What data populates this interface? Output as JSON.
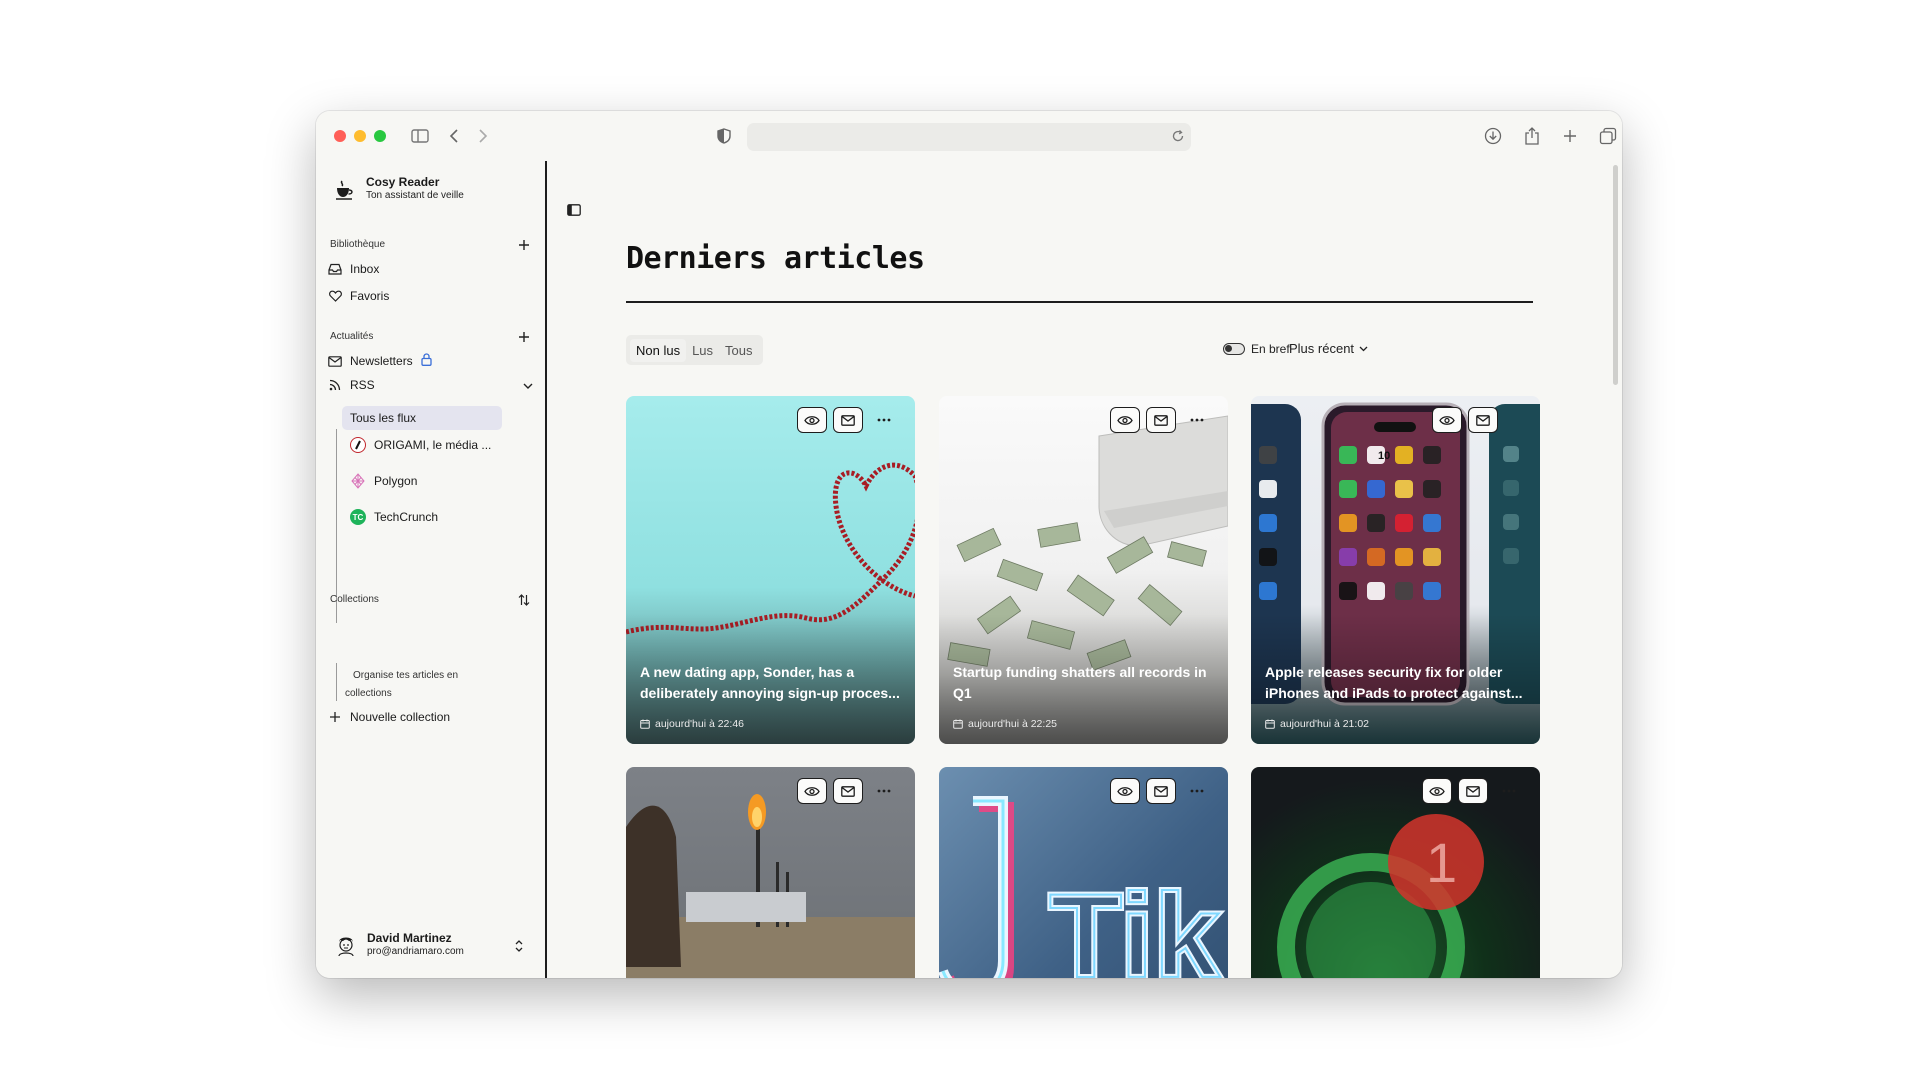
{
  "app": {
    "name": "Cosy Reader",
    "tagline": "Ton assistant de veille"
  },
  "sidebar": {
    "library": {
      "heading": "Bibliothèque",
      "items": [
        {
          "label": "Inbox",
          "icon": "inbox-icon"
        },
        {
          "label": "Favoris",
          "icon": "heart-icon"
        }
      ]
    },
    "news": {
      "heading": "Actualités",
      "newsletters_label": "Newsletters",
      "rss_label": "RSS",
      "feeds": [
        {
          "label": "Tous les flux",
          "active": true
        },
        {
          "label": "ORIGAMI, le média ...",
          "icon": "origami-favicon"
        },
        {
          "label": "Polygon",
          "icon": "polygon-favicon"
        },
        {
          "label": "TechCrunch",
          "icon": "techcrunch-favicon"
        }
      ]
    },
    "collections": {
      "heading": "Collections",
      "hint": "Organise tes articles en collections",
      "new_label": "Nouvelle collection"
    },
    "user": {
      "name": "David Martinez",
      "email": "pro@andriamaro.com"
    }
  },
  "main": {
    "title": "Derniers articles",
    "filters": [
      {
        "label": "Non lus",
        "active": true
      },
      {
        "label": "Lus",
        "active": false
      },
      {
        "label": "Tous",
        "active": false
      }
    ],
    "brief_label": "En bref",
    "sort_label": "Plus récent",
    "cards": [
      {
        "title": "A new dating app, Sonder, has a deliberately annoying sign-up proces...",
        "date": "aujourd'hui à 22:46",
        "image": "red-rope-heart"
      },
      {
        "title": "Startup funding shatters all records in Q1",
        "date": "aujourd'hui à 22:25",
        "image": "money-air-conditioner"
      },
      {
        "title": "Apple releases security fix for older iPhones and iPads to protect against...",
        "date": "aujourd'hui à 21:02",
        "image": "iphones-homescreen"
      },
      {
        "title": "",
        "date": "",
        "image": "gas-flare-field"
      },
      {
        "title": "",
        "date": "",
        "image": "tiktok-neon-sign"
      },
      {
        "title": "",
        "date": "",
        "image": "whatsapp-notification"
      }
    ]
  },
  "colors": {
    "background": "#f7f7f4",
    "accent_active_feed": "#e4e4ef",
    "lock_blue": "#3b6fd8",
    "border": "#1d1d1d"
  }
}
